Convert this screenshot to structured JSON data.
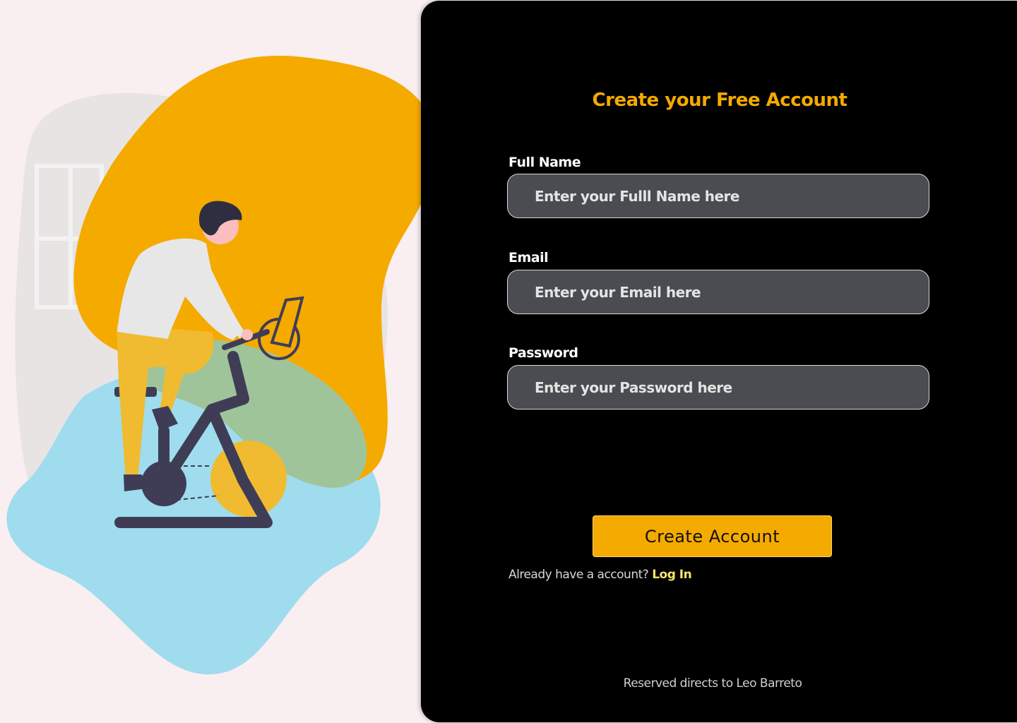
{
  "form": {
    "title": "Create your Free Account",
    "fields": {
      "full_name": {
        "label": "Full Name",
        "placeholder": "Enter your Fulll Name here",
        "value": ""
      },
      "email": {
        "label": "Email",
        "placeholder": "Enter your Email here",
        "value": ""
      },
      "password": {
        "label": "Password",
        "placeholder": "Enter your Password here",
        "value": ""
      }
    },
    "submit_label": "Create Account",
    "login_prompt": "Already have a account?",
    "login_link": "Log In"
  },
  "footer": {
    "text": "Reserved directs to Leo Barreto"
  },
  "illustration": {
    "subject": "person-riding-exercise-bike",
    "colors": {
      "accent": "#f5aa00",
      "blue_blob": "#9fdcee",
      "gray_blob": "#e8e4e4",
      "green_blob": "#a0c49a",
      "dark": "#3f3d56"
    }
  },
  "colors": {
    "background": "#f9eff0",
    "panel": "#000000",
    "accent": "#f5aa00",
    "input_bg": "#4a4c51",
    "link": "#f6e56a"
  }
}
